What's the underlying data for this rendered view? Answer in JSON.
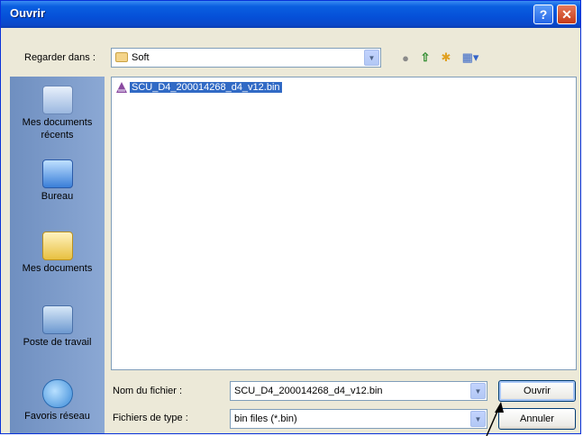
{
  "dialog": {
    "title": "Ouvrir",
    "help_button": "?",
    "close_button": "✕"
  },
  "lookin": {
    "label": "Regarder dans :",
    "value": "Soft"
  },
  "toolbar": {
    "back_icon": "back-icon",
    "up_icon": "up-folder-icon",
    "new_folder_icon": "new-folder-icon",
    "view_icon": "view-menu-icon"
  },
  "places": [
    {
      "label": "Mes documents récents",
      "icon": "recent-documents-icon"
    },
    {
      "label": "Bureau",
      "icon": "desktop-icon"
    },
    {
      "label": "Mes documents",
      "icon": "my-documents-icon"
    },
    {
      "label": "Poste de travail",
      "icon": "my-computer-icon"
    },
    {
      "label": "Favoris réseau",
      "icon": "network-places-icon"
    }
  ],
  "files": [
    {
      "name": "SCU_D4_200014268_d4_v12.bin",
      "selected": true
    }
  ],
  "filename": {
    "label": "Nom du fichier :",
    "value": "SCU_D4_200014268_d4_v12.bin"
  },
  "filetype": {
    "label": "Fichiers de type :",
    "value": "bin files (*.bin)"
  },
  "buttons": {
    "open": "Ouvrir",
    "cancel": "Annuler"
  },
  "colors": {
    "titlebar": "#0550d8",
    "selection": "#316ac5",
    "places_bar": "#7f9cc4"
  }
}
